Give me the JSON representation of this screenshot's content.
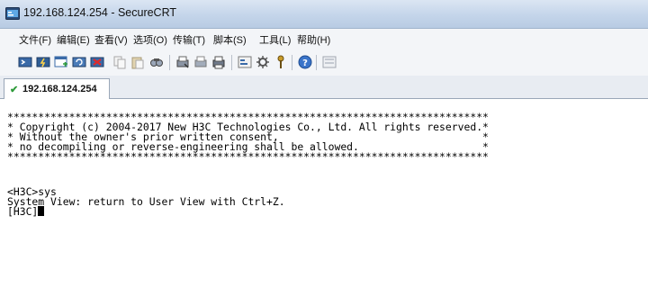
{
  "window": {
    "title": "192.168.124.254 - SecureCRT"
  },
  "menu": {
    "file": "文件(F)",
    "edit": "编辑(E)",
    "view": "查看(V)",
    "options": "选项(O)",
    "transfer": "传输(T)",
    "script": "脚本(S)",
    "tools": "工具(L)",
    "help": "帮助(H)"
  },
  "tab": {
    "label": "192.168.124.254"
  },
  "terminal": {
    "lines": [
      "******************************************************************************",
      "* Copyright (c) 2004-2017 New H3C Technologies Co., Ltd. All rights reserved.*",
      "* Without the owner's prior written consent,                                 *",
      "* no decompiling or reverse-engineering shall be allowed.                    *",
      "******************************************************************************",
      "<H3C>sys",
      "System View: return to User View with Ctrl+Z.",
      "[H3C]"
    ]
  },
  "icons": {
    "app": "securecrt-icon",
    "connected": "check-icon"
  }
}
